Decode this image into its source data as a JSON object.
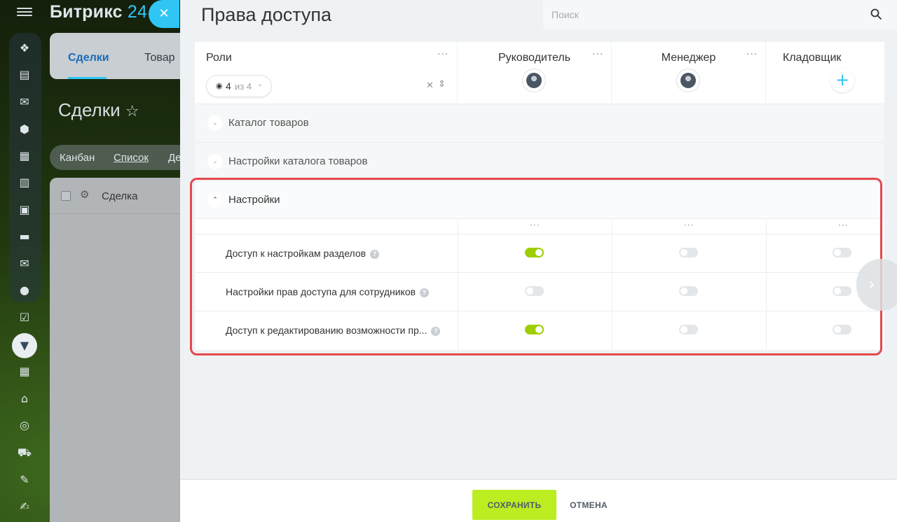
{
  "app": {
    "brand_name": "Битрикс",
    "brand_number": "24"
  },
  "left_rail": {
    "icons": [
      "stream-icon",
      "calendar-widget-icon",
      "chat-icon",
      "box-icon",
      "calendar-icon",
      "document-icon",
      "presentation-icon",
      "drive-icon",
      "mail-icon",
      "groups-icon",
      "tasks-icon",
      "crm-funnel-icon",
      "reports-icon",
      "store-icon",
      "target-icon",
      "cart-icon",
      "edit-doc-icon",
      "sign-icon"
    ]
  },
  "deals_page": {
    "tabs": [
      "Сделки",
      "Товар"
    ],
    "title": "Сделки",
    "views": [
      "Канбан",
      "Список",
      "Де"
    ],
    "table_column": "Сделка"
  },
  "panel": {
    "title": "Права доступа",
    "search_placeholder": "Поиск",
    "roles_label": "Роли",
    "counter": {
      "visible": "4",
      "of_label": "из 4"
    },
    "roles": [
      {
        "name": "Руководитель",
        "has_avatar": true
      },
      {
        "name": "Менеджер",
        "has_avatar": true
      },
      {
        "name": "Кладовщик",
        "has_avatar": false
      }
    ],
    "sections": [
      {
        "label": "Каталог товаров",
        "expanded": false
      },
      {
        "label": "Настройки каталога товаров",
        "expanded": false
      },
      {
        "label": "Настройки",
        "expanded": true
      }
    ],
    "permissions": [
      {
        "label": "Доступ к настройкам разделов",
        "values": [
          true,
          false,
          false
        ]
      },
      {
        "label": "Настройки прав доступа для сотрудников",
        "values": [
          false,
          false,
          false
        ]
      },
      {
        "label": "Доступ к редактированию возможности пр...",
        "values": [
          true,
          false,
          false
        ]
      }
    ],
    "colors": {
      "accent": "#2fc6f6",
      "toggle_on": "#9dcf00",
      "save_button": "#bbed21",
      "highlight": "#e5484d"
    }
  },
  "footer": {
    "save_label": "СОХРАНИТЬ",
    "cancel_label": "ОТМЕНА"
  }
}
